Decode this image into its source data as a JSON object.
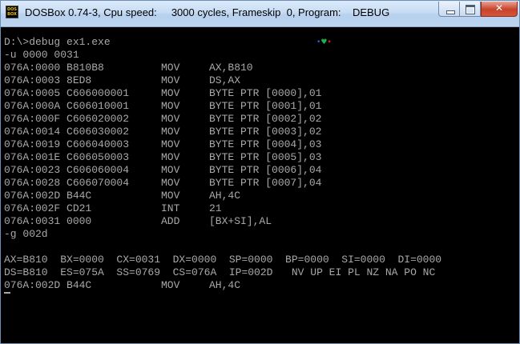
{
  "window": {
    "title": "DOSBox 0.74-3, Cpu speed:     3000 cycles, Frameskip  0, Program:    DEBUG",
    "icon_top": "DOS",
    "icon_bottom": "BOX",
    "icons": {
      "app": "dosbox-icon",
      "minimize": "minimize-icon",
      "maximize": "maximize-icon",
      "close": "close-icon"
    },
    "close_glyph": "✕",
    "colors": {
      "console_bg": "#000000",
      "console_fg": "#a8a8a8",
      "titlebar": "#c7dcf3",
      "close": "#c7432a"
    }
  },
  "console": {
    "indicator": {
      "a": "•",
      "b": "♥",
      "c": "•"
    },
    "lines": [
      {
        "c0": "D:\\>debug ex1.exe"
      },
      {
        "c0": "-u 0000 0031"
      },
      {
        "c0": "076A:0000 B810B8",
        "c1": "MOV",
        "c2": "AX,B810"
      },
      {
        "c0": "076A:0003 8ED8",
        "c1": "MOV",
        "c2": "DS,AX"
      },
      {
        "c0": "076A:0005 C606000001",
        "c1": "MOV",
        "c2": "BYTE PTR [0000],01"
      },
      {
        "c0": "076A:000A C606010001",
        "c1": "MOV",
        "c2": "BYTE PTR [0001],01"
      },
      {
        "c0": "076A:000F C606020002",
        "c1": "MOV",
        "c2": "BYTE PTR [0002],02"
      },
      {
        "c0": "076A:0014 C606030002",
        "c1": "MOV",
        "c2": "BYTE PTR [0003],02"
      },
      {
        "c0": "076A:0019 C606040003",
        "c1": "MOV",
        "c2": "BYTE PTR [0004],03"
      },
      {
        "c0": "076A:001E C606050003",
        "c1": "MOV",
        "c2": "BYTE PTR [0005],03"
      },
      {
        "c0": "076A:0023 C606060004",
        "c1": "MOV",
        "c2": "BYTE PTR [0006],04"
      },
      {
        "c0": "076A:0028 C606070004",
        "c1": "MOV",
        "c2": "BYTE PTR [0007],04"
      },
      {
        "c0": "076A:002D B44C",
        "c1": "MOV",
        "c2": "AH,4C"
      },
      {
        "c0": "076A:002F CD21",
        "c1": "INT",
        "c2": "21"
      },
      {
        "c0": "076A:0031 0000",
        "c1": "ADD",
        "c2": "[BX+SI],AL"
      },
      {
        "c0": "-g 002d"
      },
      {
        "c0": ""
      },
      {
        "c0": "AX=B810  BX=0000  CX=0031  DX=0000  SP=0000  BP=0000  SI=0000  DI=0000"
      },
      {
        "c0": "DS=B810  ES=075A  SS=0769  CS=076A  IP=002D   NV UP EI PL NZ NA PO NC"
      },
      {
        "c0": "076A:002D B44C",
        "c1": "MOV",
        "c2": "AH,4C"
      }
    ]
  }
}
